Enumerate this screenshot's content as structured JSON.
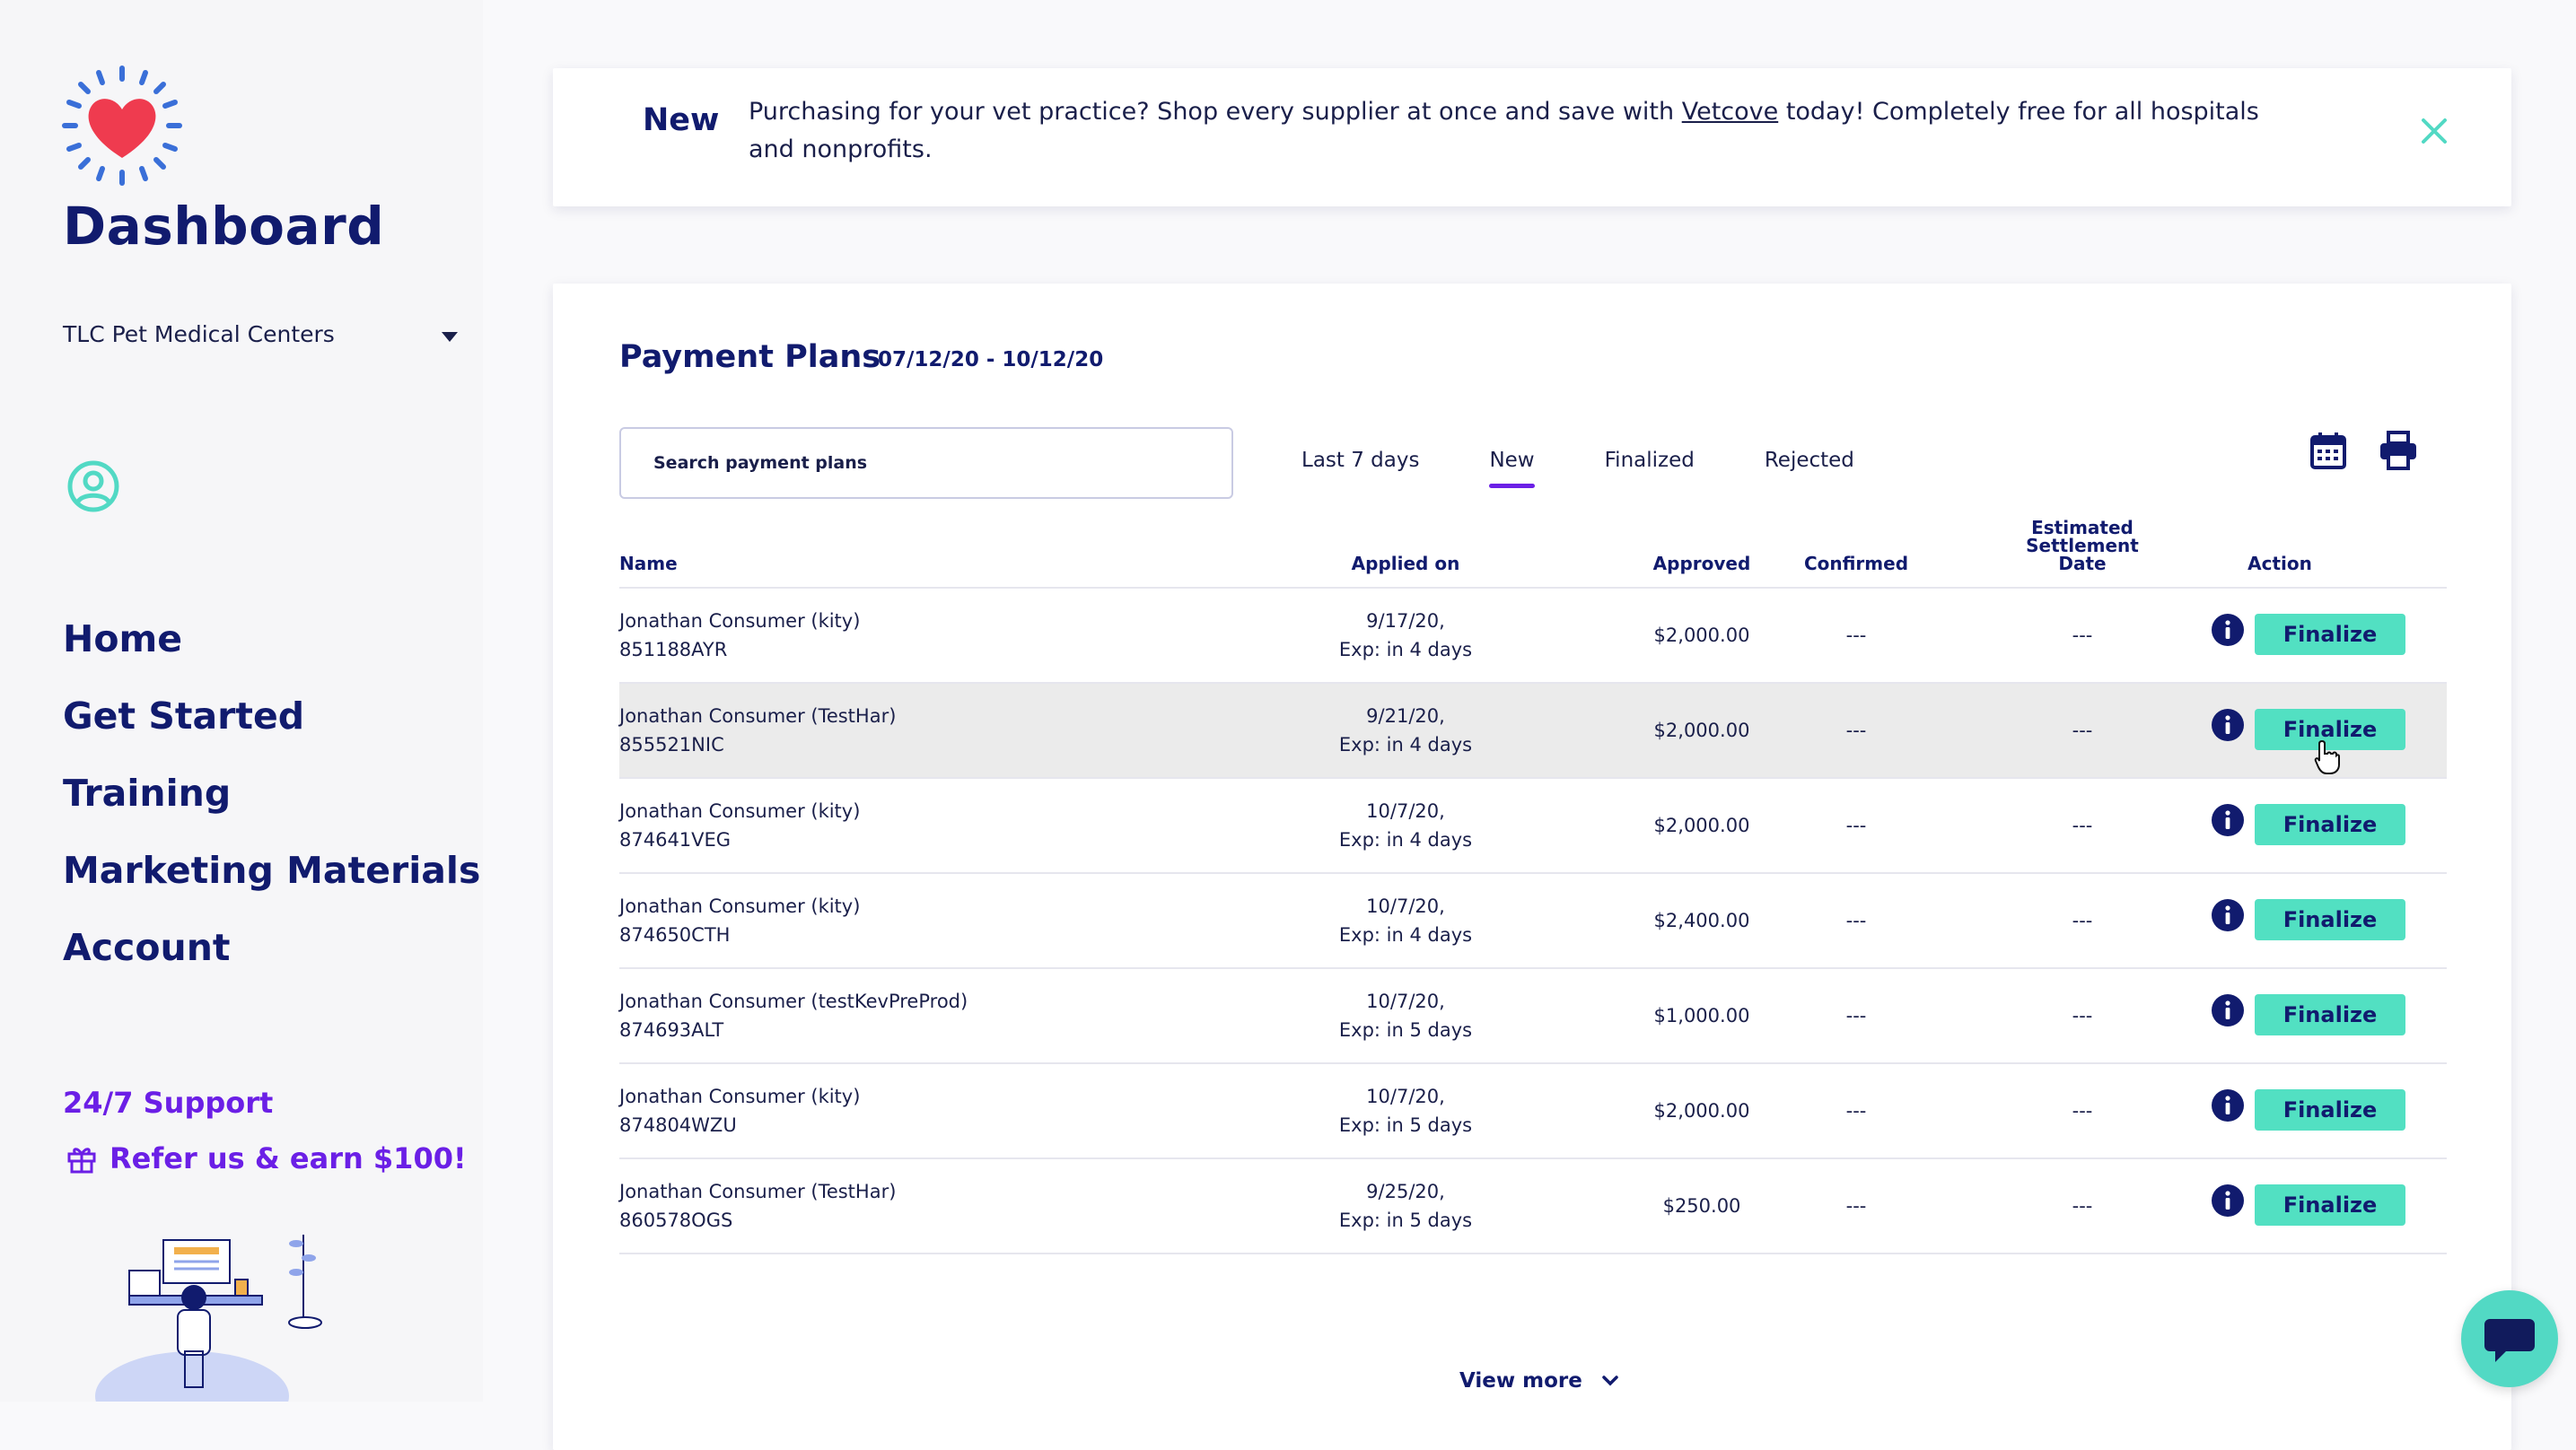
{
  "sidebar": {
    "title": "Dashboard",
    "practice": "TLC Pet Medical Centers",
    "nav": [
      "Home",
      "Get Started",
      "Training",
      "Marketing Materials",
      "Account"
    ],
    "support": "24/7 Support",
    "refer": "Refer us & earn $100!"
  },
  "banner": {
    "tag": "New",
    "text_before": "Purchasing for your vet practice? Shop every supplier at once and save with ",
    "link": "Vetcove",
    "text_after": " today! Completely free for all hospitals and nonprofits."
  },
  "plans": {
    "title": "Payment Plans",
    "range": "07/12/20 - 10/12/20",
    "search_placeholder": "Search payment plans",
    "tabs": [
      "Last 7 days",
      "New",
      "Finalized",
      "Rejected"
    ],
    "active_tab": "New",
    "headers": {
      "name": "Name",
      "applied": "Applied on",
      "approved": "Approved",
      "confirmed": "Confirmed",
      "estimated": "Estimated Settlement Date",
      "action": "Action"
    },
    "rows": [
      {
        "name": "Jonathan Consumer (kity)",
        "id": "851188AYR",
        "date": "9/17/20,",
        "exp": "Exp: in 4 days",
        "approved": "$2,000.00",
        "confirmed": "---",
        "estimated": "---",
        "action": "Finalize"
      },
      {
        "name": "Jonathan Consumer (TestHar)",
        "id": "855521NIC",
        "date": "9/21/20,",
        "exp": "Exp: in 4 days",
        "approved": "$2,000.00",
        "confirmed": "---",
        "estimated": "---",
        "action": "Finalize"
      },
      {
        "name": "Jonathan Consumer (kity)",
        "id": "874641VEG",
        "date": "10/7/20,",
        "exp": "Exp: in 4 days",
        "approved": "$2,000.00",
        "confirmed": "---",
        "estimated": "---",
        "action": "Finalize"
      },
      {
        "name": "Jonathan Consumer (kity)",
        "id": "874650CTH",
        "date": "10/7/20,",
        "exp": "Exp: in 4 days",
        "approved": "$2,400.00",
        "confirmed": "---",
        "estimated": "---",
        "action": "Finalize"
      },
      {
        "name": "Jonathan Consumer (testKevPreProd)",
        "id": "874693ALT",
        "date": "10/7/20,",
        "exp": "Exp: in 5 days",
        "approved": "$1,000.00",
        "confirmed": "---",
        "estimated": "---",
        "action": "Finalize"
      },
      {
        "name": "Jonathan Consumer (kity)",
        "id": "874804WZU",
        "date": "10/7/20,",
        "exp": "Exp: in 5 days",
        "approved": "$2,000.00",
        "confirmed": "---",
        "estimated": "---",
        "action": "Finalize"
      },
      {
        "name": "Jonathan Consumer (TestHar)",
        "id": "860578OGS",
        "date": "9/25/20,",
        "exp": "Exp: in 5 days",
        "approved": "$250.00",
        "confirmed": "---",
        "estimated": "---",
        "action": "Finalize"
      }
    ],
    "view_more": "View more"
  },
  "colors": {
    "navy": "#111b6e",
    "purple": "#6b1fe6",
    "teal": "#52e0c2",
    "heart": "#ef3b4f",
    "rays": "#3a6fd8"
  },
  "icons": [
    "heart-logo-icon",
    "caret-down-icon",
    "user-circle-icon",
    "gift-icon",
    "close-icon",
    "calendar-icon",
    "printer-icon",
    "info-icon",
    "chevron-down-icon",
    "chat-icon",
    "pointer-cursor-icon"
  ]
}
